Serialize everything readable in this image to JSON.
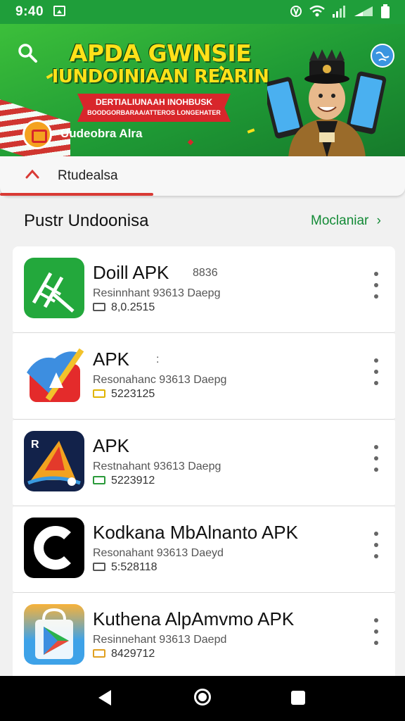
{
  "status_bar": {
    "time": "9:40",
    "icons": [
      "image-icon",
      "nfc-icon",
      "wifi-icon",
      "signal-icon",
      "signal-icon",
      "battery-icon"
    ]
  },
  "banner": {
    "title_line1": "APDA GWNSIE",
    "title_line2": "IUNDOINIAAN REARIN",
    "ribbon_line1": "DERTIALIUNAAH INOHBUSK",
    "ribbon_line2": "BOODGORBARAA/ATTEROS LONGEHATER",
    "badge_text": "Uudeobra Alra",
    "colors": {
      "green": "#1f9a35",
      "yellow": "#ffe11a",
      "red": "#d8262b"
    }
  },
  "tabs": {
    "active_label": "Rtudealsa"
  },
  "section": {
    "title": "Pustr Undoonisa",
    "more_label": "Moclaniar"
  },
  "apps": [
    {
      "name": "Doill APK",
      "tag": "8836",
      "subtitle": "Resinnhant 93613 Daepg",
      "size": "8,0.2515",
      "size_badge_color": "#555555",
      "icon": "ladder-icon"
    },
    {
      "name": "APK",
      "tag": ":",
      "subtitle": "Resonahanc 93613 Daepg",
      "size": "5223125",
      "size_badge_color": "#e0b400",
      "icon": "paper-plane-icon"
    },
    {
      "name": "APK",
      "tag": "",
      "subtitle": "Restnahant 93613 Daepg",
      "size": "5223912",
      "size_badge_color": "#2a9a3a",
      "icon": "sail-icon"
    },
    {
      "name": "Kodkana MbAlnanto APK",
      "tag": "",
      "subtitle": "Resonahant 93613 Daeyd",
      "size": "5:528118",
      "size_badge_color": "#555555",
      "icon": "c-letter-icon"
    },
    {
      "name": "Kuthena AlpAmvmo APK",
      "tag": "",
      "subtitle": "Resinnehant 93613 Daepd",
      "size": "8429712",
      "size_badge_color": "#e0a020",
      "icon": "shopping-bag-icon"
    }
  ]
}
